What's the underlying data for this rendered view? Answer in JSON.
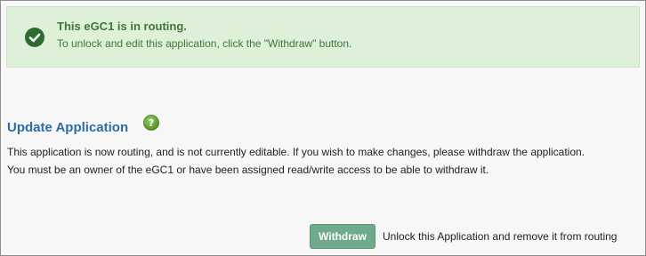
{
  "alert": {
    "title": "This eGC1 is in routing.",
    "message": "To unlock and edit this application, click the \"Withdraw\" button.",
    "icon": "check-circle-icon",
    "color": "#3c763d",
    "background": "#dff0d8"
  },
  "section": {
    "heading": "Update Application",
    "help_icon": "help-icon",
    "line1": "This application is now routing, and is not currently editable. If you wish to make changes, please withdraw the application.",
    "line2": "You must be an owner of the eGC1 or have been assigned read/write access to be able to withdraw it."
  },
  "actions": {
    "withdraw_label": "Withdraw",
    "withdraw_description": "Unlock this Application and remove it from routing"
  }
}
